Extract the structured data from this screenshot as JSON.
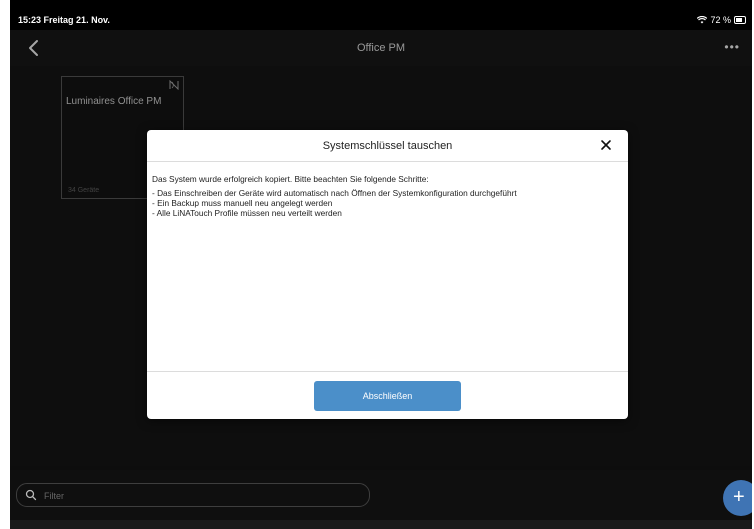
{
  "statusbar": {
    "time": "15:23",
    "date": "Freitag 21. Nov.",
    "battery": "72 %"
  },
  "navbar": {
    "title": "Office PM",
    "more_icon": "more-horizontal-icon"
  },
  "card": {
    "title": "Luminaires Office PM",
    "footer": "34 Geräte"
  },
  "modal": {
    "title": "Systemschlüssel tauschen",
    "lead": "Das System wurde erfolgreich kopiert. Bitte beachten Sie folgende Schritte:",
    "steps": [
      "- Das Einschreiben der Geräte wird automatisch nach Öffnen der Systemkonfiguration durchgeführt",
      "- Ein Backup muss manuell neu angelegt werden",
      "- Alle LiNATouch Profile müssen neu verteilt werden"
    ],
    "finish_label": "Abschließen"
  },
  "filter": {
    "placeholder": "Filter"
  },
  "colors": {
    "accent": "#4b8fc9",
    "add_button": "#3f74b4"
  }
}
